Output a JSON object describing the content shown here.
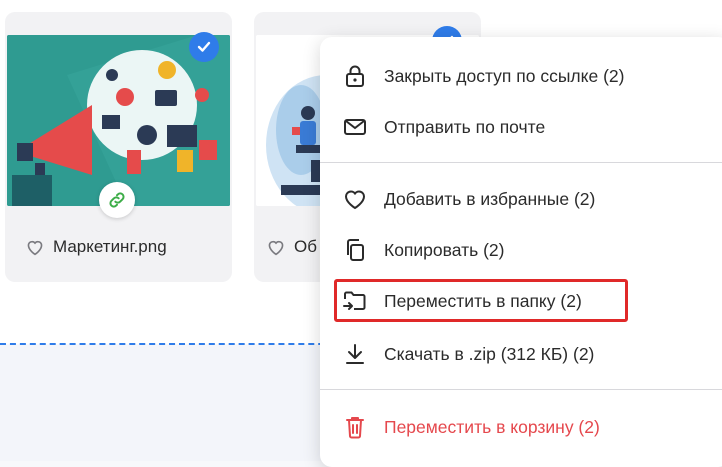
{
  "files": [
    {
      "name": "Маркетинг.png",
      "selected": true,
      "shared": true
    },
    {
      "name": "Об",
      "selected": true,
      "shared": false
    }
  ],
  "menu": {
    "items": [
      {
        "label": "Закрыть доступ по ссылке (2)",
        "icon": "lock-icon"
      },
      {
        "label": "Отправить по почте",
        "icon": "envelope-icon"
      },
      {
        "label": "Добавить в избранные (2)",
        "icon": "heart-icon"
      },
      {
        "label": "Копировать (2)",
        "icon": "copy-icon"
      },
      {
        "label": "Переместить в папку (2)",
        "icon": "folder-move-icon",
        "highlighted": true
      },
      {
        "label": "Скачать в .zip (312 КБ) (2)",
        "icon": "download-icon"
      },
      {
        "label": "Переместить в корзину (2)",
        "icon": "trash-icon",
        "danger": true
      }
    ]
  },
  "colors": {
    "accent": "#2f7ce9",
    "danger": "#e5484d",
    "highlight": "#e02929"
  }
}
